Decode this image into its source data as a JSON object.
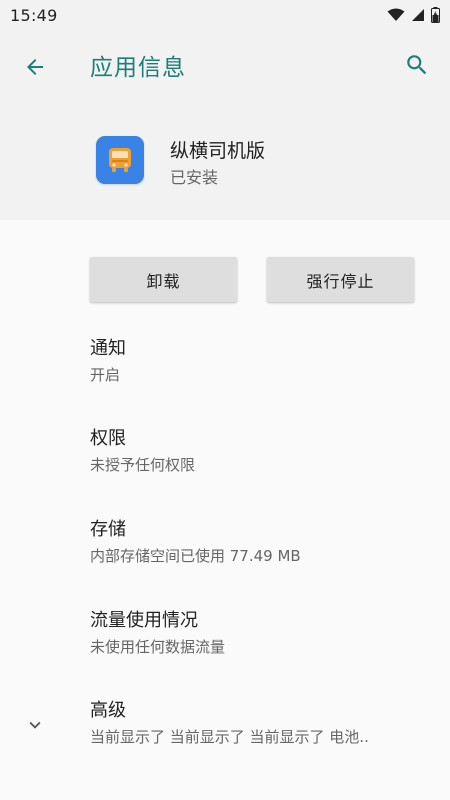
{
  "status_bar": {
    "time": "15:49",
    "icons": [
      "wifi-icon",
      "signal-icon",
      "battery-icon"
    ]
  },
  "app_bar": {
    "title": "应用信息",
    "icons": [
      "back-arrow-icon",
      "search-icon"
    ],
    "accent_color": "#1b7f78"
  },
  "app": {
    "name": "纵横司机版",
    "status": "已安装",
    "icon": "bus-icon",
    "icon_color": "#3a83e6"
  },
  "buttons": {
    "uninstall": "卸载",
    "force_stop": "强行停止"
  },
  "settings": [
    {
      "title": "通知",
      "subtitle": "开启"
    },
    {
      "title": "权限",
      "subtitle": "未授予任何权限"
    },
    {
      "title": "存储",
      "subtitle": "内部存储空间已使用 77.49 MB"
    },
    {
      "title": "流量使用情况",
      "subtitle": "未使用任何数据流量"
    },
    {
      "title": "高级",
      "subtitle": "当前显示了 当前显示了 当前显示了 电池.."
    }
  ]
}
